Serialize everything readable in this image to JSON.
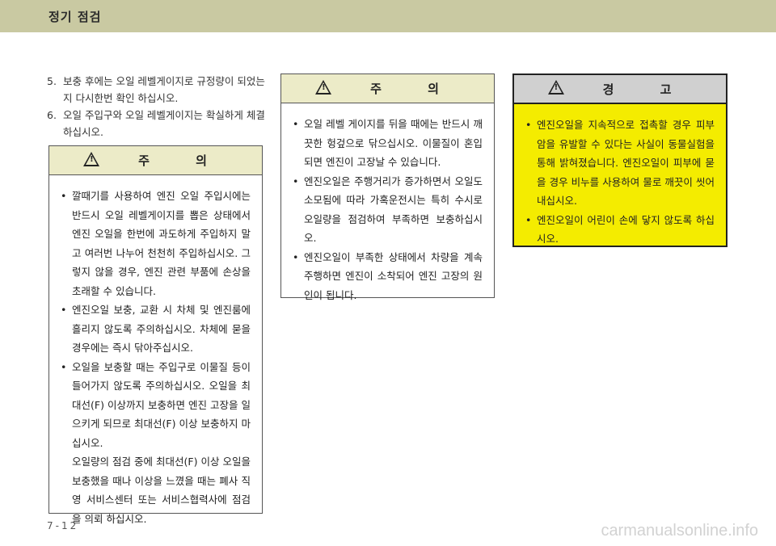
{
  "header": {
    "title": "정기 점검"
  },
  "steps": [
    {
      "num": "5.",
      "text": "보충 후에는 오일 레벨게이지로 규정량이 되었는지 다시한번 확인 하십시오."
    },
    {
      "num": "6.",
      "text": "오일 주입구와 오일 레벨게이지는 확실하게 체결하십시오."
    }
  ],
  "caution_left": {
    "heading": "주 의",
    "items": [
      "깔때기를 사용하여 엔진 오일 주입시에는 반드시 오일 레벨게이지를 뽑은 상태에서 엔진 오일을 한번에 과도하게 주입하지 말고 여러번 나누어 천천히 주입하십시오. 그렇지 않을 경우, 엔진 관련 부품에 손상을 초래할 수 있습니다.",
      "엔진오일 보충, 교환 시 차체 및 엔진룸에 흘리지 않도록 주의하십시오. 차체에 묻을 경우에는 즉시 닦아주십시오.",
      "오일을 보충할 때는 주입구로 이물질 등이 들어가지 않도록 주의하십시오. 오일을 최대선(F) 이상까지 보충하면 엔진 고장을 일으키게 되므로 최대선(F) 이상 보충하지 마십시오."
    ],
    "extra": "오일량의 점검 중에 최대선(F) 이상 오일을 보충했을 때나 이상을 느꼈을 때는 폐사 직영 서비스센터 또는 서비스협력사에 점검을 의뢰 하십시오."
  },
  "caution_middle": {
    "heading": "주 의",
    "items": [
      "오일 레벨 게이지를 뒤을 때에는 반드시 깨끗한 헝겊으로 닦으십시오. 이물질이 혼입되면 엔진이 고장날 수 있습니다.",
      "엔진오일은 주행거리가 증가하면서 오일도 소모됨에 따라 가혹운전시는 특히 수시로 오일량을 점검하여 부족하면 보충하십시오.",
      "엔진오일이 부족한 상태에서 차량을 계속 주행하면 엔진이 소착되어 엔진 고장의 원인이 됩니다."
    ]
  },
  "warning_right": {
    "heading": "경 고",
    "items": [
      "엔진오일을 지속적으로 접촉할 경우 피부암을 유발할 수 있다는 사실이 동물실험을 통해 밝혀졌습니다. 엔진오일이 피부에 묻을 경우 비누를 사용하여 물로 깨끗이 씻어 내십시오.",
      "엔진오일이 어린이 손에 닿지 않도록 하십시오."
    ],
    "colors": {
      "background": "#f4ec00",
      "header": "#d0d0d0"
    }
  },
  "footer": {
    "page_number": "7-12",
    "watermark": "carmanualsonline.info"
  }
}
